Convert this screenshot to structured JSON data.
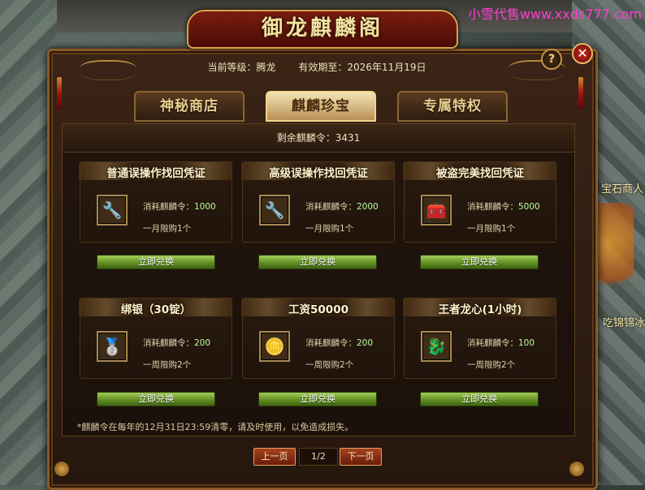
{
  "watermark": "小雪代售www.xxds777.com",
  "world": {
    "npc_label_1": "宝石商人",
    "npc_label_2": "吃锦锦冰"
  },
  "window": {
    "title": "御龙麒麟阁",
    "help_label": "?",
    "close_label": "✕",
    "current_level_label": "当前等级：",
    "current_level": "腾龙",
    "valid_until_label": "有效期至：",
    "valid_until": "2026年11月19日"
  },
  "tabs": [
    {
      "label": "神秘商店",
      "active": false
    },
    {
      "label": "麒麟珍宝",
      "active": true
    },
    {
      "label": "专属特权",
      "active": false
    }
  ],
  "remaining": {
    "label": "剩余麒麟令：",
    "value": "3431"
  },
  "cost_label": "消耗麒麟令：",
  "items": [
    {
      "title": "普通误操作找回凭证",
      "icon": "wrench-icon",
      "glyph": "🔧",
      "cost": "1000",
      "limit": "一月限购1个",
      "button": "立即兑换"
    },
    {
      "title": "高级误操作找回凭证",
      "icon": "wrench-icon",
      "glyph": "🔧",
      "cost": "2000",
      "limit": "一月限购1个",
      "button": "立即兑换"
    },
    {
      "title": "被盗完美找回凭证",
      "icon": "treasure-chest-icon",
      "glyph": "🧰",
      "cost": "5000",
      "limit": "一月限购1个",
      "button": "立即兑换"
    },
    {
      "title": "绑银（30锭）",
      "icon": "silver-ingot-icon",
      "glyph": "🥈",
      "cost": "200",
      "limit": "一周限购2个",
      "button": "立即兑换"
    },
    {
      "title": "工资50000",
      "icon": "gold-ingot-icon",
      "glyph": "🪙",
      "cost": "200",
      "limit": "一周限购2个",
      "button": "立即兑换"
    },
    {
      "title": "王者龙心(1小时)",
      "icon": "dragon-heart-icon",
      "glyph": "🐉",
      "cost": "100",
      "limit": "一周限购2个",
      "button": "立即兑换"
    }
  ],
  "notice": "*麒麟令在每年的12月31日23:59清零，请及时使用，以免造成损失。",
  "pager": {
    "prev": "上一页",
    "page": "1/2",
    "next": "下一页"
  },
  "colors": {
    "accent_gold": "#d6a34b",
    "button_green": "#5c8a1f",
    "cost_green": "#b8ff9a"
  }
}
